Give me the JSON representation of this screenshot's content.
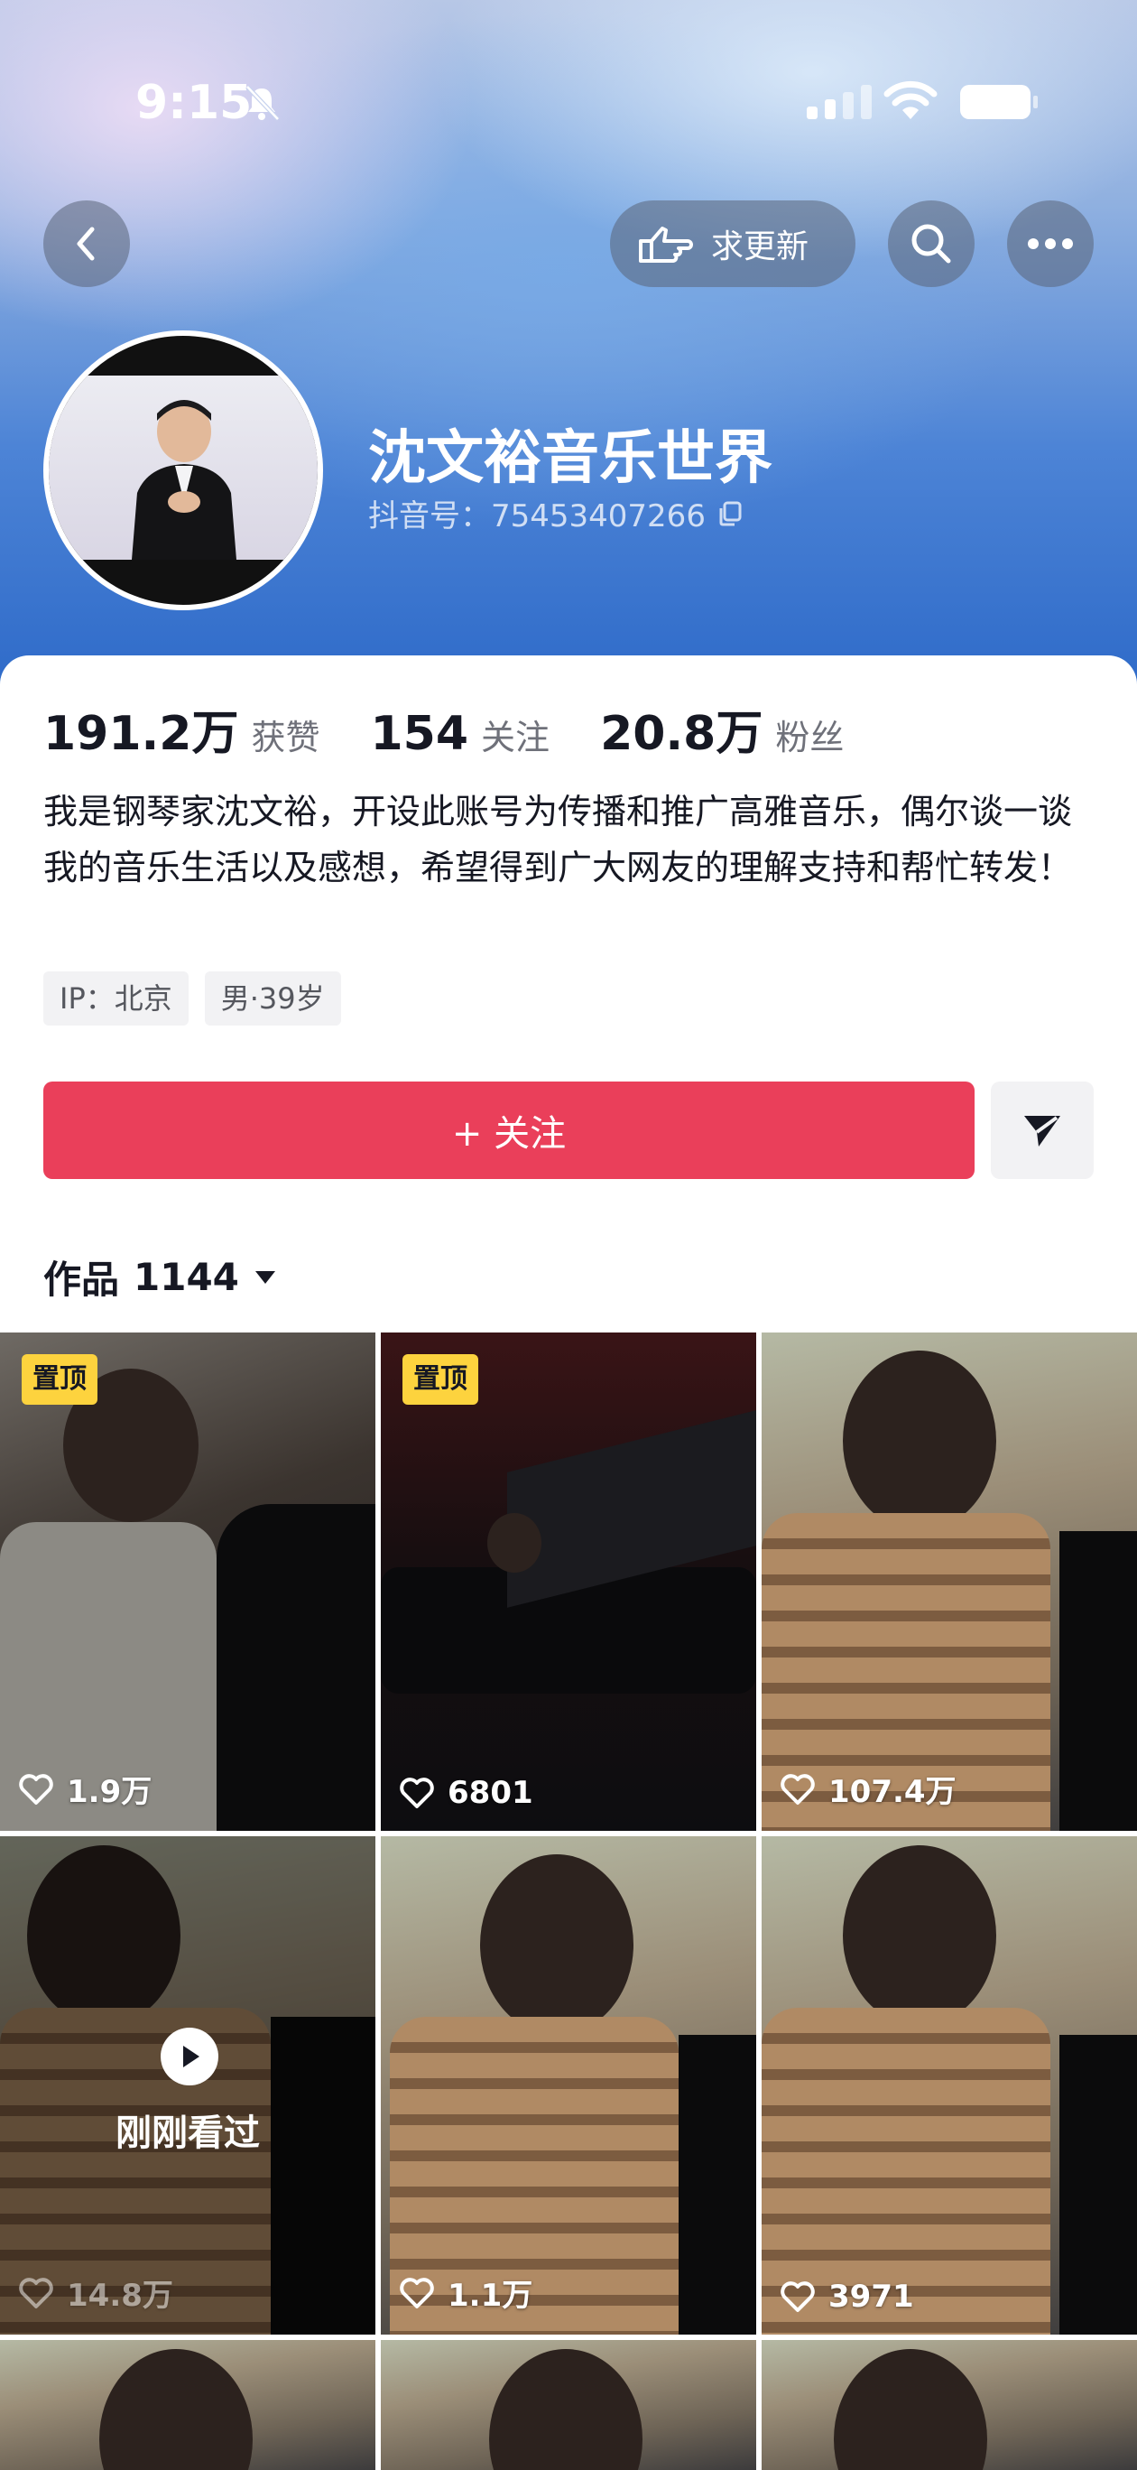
{
  "status_bar": {
    "time": "9:15"
  },
  "top_bar": {
    "update_label": "求更新"
  },
  "profile": {
    "name": "沈文裕音乐世界",
    "id_label": "抖音号：",
    "id_value": "75453407266"
  },
  "stats": {
    "likes_value": "191.2万",
    "likes_label": "获赞",
    "following_value": "154",
    "following_label": "关注",
    "followers_value": "20.8万",
    "followers_label": "粉丝"
  },
  "bio": "我是钢琴家沈文裕，开设此账号为传播和推广高雅音乐，偶尔谈一谈我的音乐生活以及感想，希望得到广大网友的理解支持和帮忙转发！",
  "tags": [
    "IP：北京",
    "男·39岁"
  ],
  "actions": {
    "follow_label": "+ 关注"
  },
  "works": {
    "tab_label": "作品",
    "count": "1144",
    "items": [
      {
        "pinned": "置顶",
        "likes": "1.9万"
      },
      {
        "pinned": "置顶",
        "likes": "6801"
      },
      {
        "likes": "107.4万"
      },
      {
        "likes": "14.8万",
        "overlay": "刚刚看过"
      },
      {
        "likes": "1.1万"
      },
      {
        "likes": "3971"
      }
    ]
  },
  "colors": {
    "accent": "#ea3f5a",
    "pin_badge": "#fdd33e"
  }
}
